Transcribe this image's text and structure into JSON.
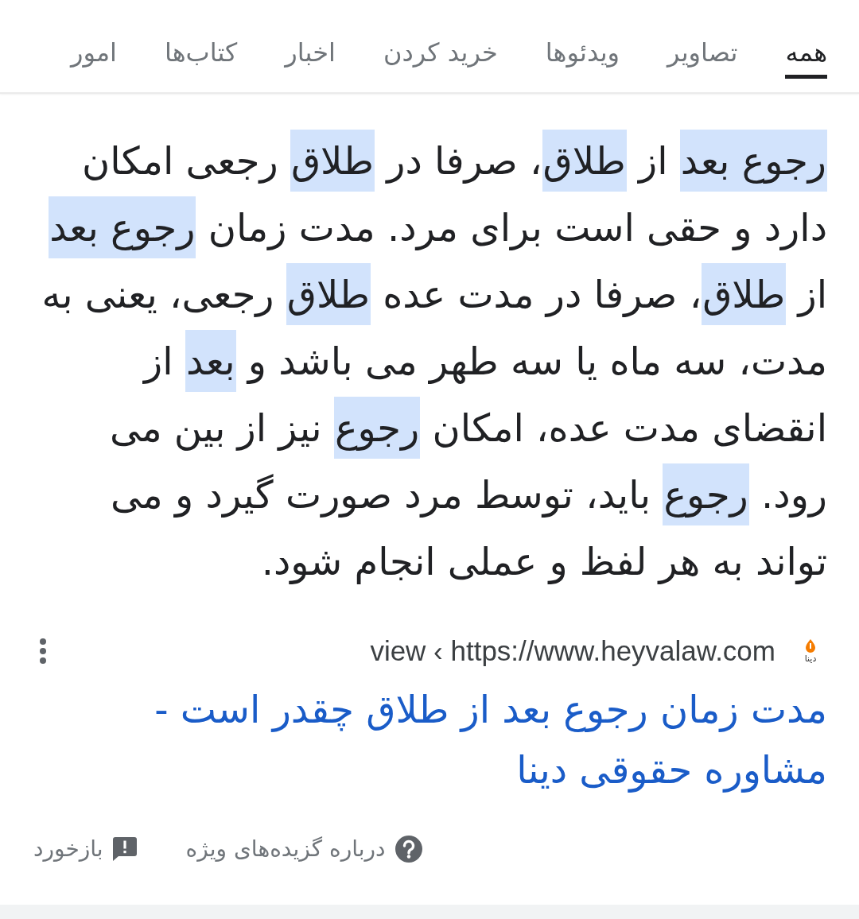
{
  "tabs": [
    {
      "label": "همه",
      "selected": true
    },
    {
      "label": "تصاویر",
      "selected": false
    },
    {
      "label": "ویدئوها",
      "selected": false
    },
    {
      "label": "خرید کردن",
      "selected": false
    },
    {
      "label": "اخبار",
      "selected": false
    },
    {
      "label": "کتاب‌ها",
      "selected": false
    },
    {
      "label": "امور",
      "selected": false
    }
  ],
  "snippet": {
    "segments": [
      {
        "text": "رجوع بعد",
        "highlighted": true
      },
      {
        "text": " از ",
        "highlighted": false
      },
      {
        "text": "طلاق",
        "highlighted": true
      },
      {
        "text": "، صرفا در ",
        "highlighted": false
      },
      {
        "text": "طلاق",
        "highlighted": true
      },
      {
        "text": " رجعی امکان دارد و حقی است برای مرد. مدت زمان ",
        "highlighted": false
      },
      {
        "text": "رجوع بعد",
        "highlighted": true
      },
      {
        "text": " از ",
        "highlighted": false
      },
      {
        "text": "طلاق",
        "highlighted": true
      },
      {
        "text": "، صرفا در مدت عده ",
        "highlighted": false
      },
      {
        "text": "طلاق",
        "highlighted": true
      },
      {
        "text": " رجعی، یعنی به مدت، سه ماه یا سه طهر می باشد و ",
        "highlighted": false
      },
      {
        "text": "بعد",
        "highlighted": true
      },
      {
        "text": " از انقضای مدت عده، امکان ",
        "highlighted": false
      },
      {
        "text": "رجوع",
        "highlighted": true
      },
      {
        "text": " نیز از بین می رود. ",
        "highlighted": false
      },
      {
        "text": "رجوع",
        "highlighted": true
      },
      {
        "text": " باید، توسط مرد صورت گیرد و می تواند به هر لفظ و عملی انجام شود.",
        "highlighted": false
      }
    ]
  },
  "result": {
    "site_logo_text": "دینا",
    "breadcrumb": "view ‹ https://www.heyvalaw.com",
    "title": "مدت زمان رجوع بعد از طلاق چقدر است - مشاوره حقوقی دینا"
  },
  "footer": [
    {
      "kind": "about",
      "label": "درباره گزیده‌های ویژه"
    },
    {
      "kind": "feedback",
      "label": "بازخورد"
    }
  ]
}
